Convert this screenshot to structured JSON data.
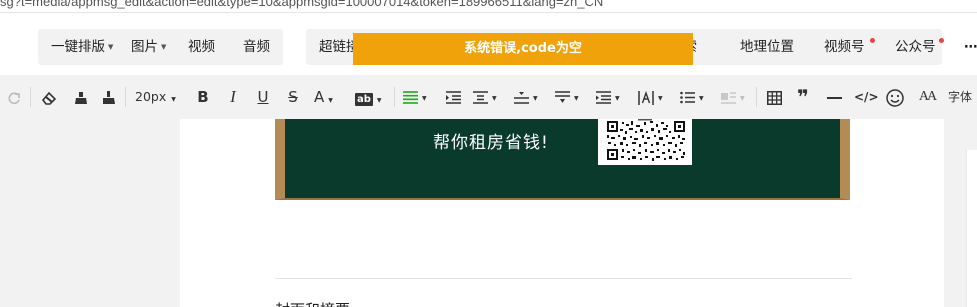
{
  "browser": {
    "url": "sg?t=media/appmsg_edit&action=edit&type=10&appmsgid=100007014&token=189966511&lang=zh_CN"
  },
  "menu_left": [
    {
      "label": "一键排版",
      "dropdown": true
    },
    {
      "label": "图片",
      "dropdown": true
    },
    {
      "label": "视频",
      "dropdown": false
    },
    {
      "label": "音频",
      "dropdown": false
    }
  ],
  "menu_right": [
    {
      "label": "超链接",
      "badge": false
    },
    {
      "label": "搜索",
      "badge": false
    },
    {
      "label": "地理位置",
      "badge": false
    },
    {
      "label": "视频号",
      "badge": true
    },
    {
      "label": "公众号",
      "badge": true
    },
    {
      "label": "⋯",
      "badge": false
    }
  ],
  "toast": {
    "message": "系统错误,code为空",
    "color": "#f0a20a"
  },
  "toolbar": {
    "font_size": "20px",
    "font_label": "字体",
    "icons": [
      "redo-icon",
      "eraser-icon",
      "format-painter-icon",
      "clear-format-icon",
      "bold-icon",
      "italic-icon",
      "underline-icon",
      "strikethrough-icon",
      "font-color-icon",
      "background-color-icon",
      "align-justify-icon",
      "indent-icon",
      "first-line-indent-icon",
      "paragraph-spacing-icon",
      "line-spacing-icon",
      "letter-spacing-icon",
      "margin-icon",
      "list-icon",
      "image-align-icon",
      "table-icon",
      "quote-icon",
      "horizontal-rule-icon",
      "code-icon",
      "emoji-icon",
      "text-style-icon"
    ],
    "bold_glyph": "B",
    "italic_glyph": "I",
    "underline_glyph": "U",
    "strike_glyph": "S",
    "font_color_glyph": "A",
    "bgcolor_glyph": "ab",
    "quote_glyph": "❞",
    "code_glyph": "</>",
    "textstyle_glyph": "AA"
  },
  "editor": {
    "banner_text": "帮你租房省钱!",
    "below_text": "封面和摘要",
    "banner_color": "#0a3a2c",
    "frame_color": "#b58b55"
  }
}
